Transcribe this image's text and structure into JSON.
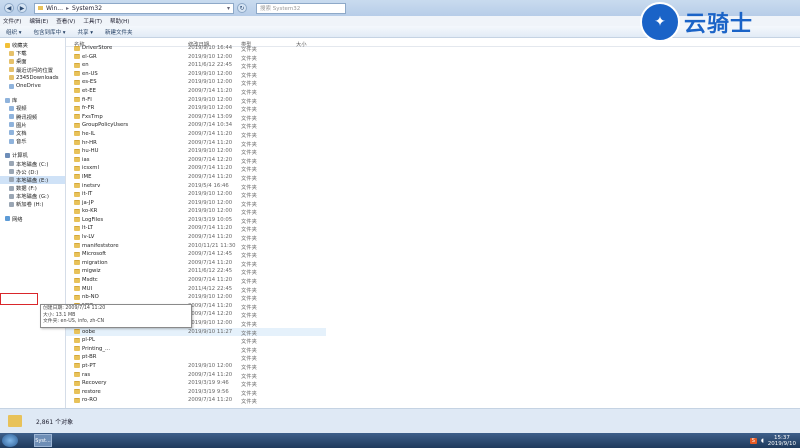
{
  "titlebar": {
    "path": [
      "Win...",
      "System32"
    ],
    "search_placeholder": "搜索 System32"
  },
  "menu": [
    "文件(F)",
    "编辑(E)",
    "查看(V)",
    "工具(T)",
    "帮助(H)"
  ],
  "toolbar": [
    "组织 ▾",
    "包含到库中 ▾",
    "共享 ▾",
    "新建文件夹"
  ],
  "sidebar": {
    "favorites": {
      "title": "收藏夹",
      "items": [
        "下载",
        "桌面",
        "最近访问的位置",
        "2345Downloads",
        "OneDrive"
      ]
    },
    "libraries": {
      "title": "库",
      "items": [
        "视频",
        "腾讯视频",
        "图片",
        "文档",
        "音乐"
      ]
    },
    "computer": {
      "title": "计算机",
      "items": [
        "本地磁盘 (C:)",
        "办公 (D:)",
        "本地磁盘 (E:)",
        "数据 (F:)",
        "本地磁盘 (G:)",
        "新加卷 (H:)"
      ]
    },
    "network": {
      "title": "网络"
    }
  },
  "columns": {
    "name": "名称",
    "date": "修改日期",
    "type": "类型",
    "size": "大小"
  },
  "files": [
    {
      "name": "DriverStore",
      "date": "2019/9/10 16:44",
      "type": "文件夹"
    },
    {
      "name": "el-GR",
      "date": "2019/9/10 12:00",
      "type": "文件夹"
    },
    {
      "name": "en",
      "date": "2011/6/12 22:45",
      "type": "文件夹"
    },
    {
      "name": "en-US",
      "date": "2019/9/10 12:00",
      "type": "文件夹"
    },
    {
      "name": "es-ES",
      "date": "2019/9/10 12:00",
      "type": "文件夹"
    },
    {
      "name": "et-EE",
      "date": "2009/7/14 11:20",
      "type": "文件夹"
    },
    {
      "name": "fi-FI",
      "date": "2019/9/10 12:00",
      "type": "文件夹"
    },
    {
      "name": "fr-FR",
      "date": "2019/9/10 12:00",
      "type": "文件夹"
    },
    {
      "name": "FxsTmp",
      "date": "2009/7/14 13:09",
      "type": "文件夹"
    },
    {
      "name": "GroupPolicyUsers",
      "date": "2009/7/14 10:34",
      "type": "文件夹"
    },
    {
      "name": "he-IL",
      "date": "2009/7/14 11:20",
      "type": "文件夹"
    },
    {
      "name": "hr-HR",
      "date": "2009/7/14 11:20",
      "type": "文件夹"
    },
    {
      "name": "hu-HU",
      "date": "2019/9/10 12:00",
      "type": "文件夹"
    },
    {
      "name": "ias",
      "date": "2009/7/14 12:20",
      "type": "文件夹"
    },
    {
      "name": "icsxml",
      "date": "2009/7/14 11:20",
      "type": "文件夹"
    },
    {
      "name": "IME",
      "date": "2009/7/14 11:20",
      "type": "文件夹"
    },
    {
      "name": "inetsrv",
      "date": "2019/5/4 16:46",
      "type": "文件夹"
    },
    {
      "name": "it-IT",
      "date": "2019/9/10 12:00",
      "type": "文件夹"
    },
    {
      "name": "ja-JP",
      "date": "2019/9/10 12:00",
      "type": "文件夹"
    },
    {
      "name": "ko-KR",
      "date": "2019/9/10 12:00",
      "type": "文件夹"
    },
    {
      "name": "LogFiles",
      "date": "2019/3/19 10:05",
      "type": "文件夹"
    },
    {
      "name": "lt-LT",
      "date": "2009/7/14 11:20",
      "type": "文件夹"
    },
    {
      "name": "lv-LV",
      "date": "2009/7/14 11:20",
      "type": "文件夹"
    },
    {
      "name": "manifeststore",
      "date": "2010/11/21 11:30",
      "type": "文件夹"
    },
    {
      "name": "Microsoft",
      "date": "2009/7/14 12:45",
      "type": "文件夹"
    },
    {
      "name": "migration",
      "date": "2009/7/14 11:20",
      "type": "文件夹"
    },
    {
      "name": "migwiz",
      "date": "2011/6/12 22:45",
      "type": "文件夹"
    },
    {
      "name": "Msdtc",
      "date": "2009/7/14 11:20",
      "type": "文件夹"
    },
    {
      "name": "MUI",
      "date": "2011/4/12 22:45",
      "type": "文件夹"
    },
    {
      "name": "nb-NO",
      "date": "2019/9/10 12:00",
      "type": "文件夹"
    },
    {
      "name": "NDF",
      "date": "2009/7/14 11:20",
      "type": "文件夹"
    },
    {
      "name": "NetworkList",
      "date": "2009/7/14 12:20",
      "type": "文件夹"
    },
    {
      "name": "nl-NL",
      "date": "2019/9/10 12:00",
      "type": "文件夹"
    },
    {
      "name": "oobe",
      "date": "2019/9/10 11:27",
      "type": "文件夹"
    },
    {
      "name": "pl-PL",
      "date": "",
      "type": "文件夹"
    },
    {
      "name": "Printing_...",
      "date": "",
      "type": "文件夹"
    },
    {
      "name": "pt-BR",
      "date": "",
      "type": "文件夹"
    },
    {
      "name": "pt-PT",
      "date": "2019/9/10 12:00",
      "type": "文件夹"
    },
    {
      "name": "ras",
      "date": "2009/7/14 11:20",
      "type": "文件夹"
    },
    {
      "name": "Recovery",
      "date": "2019/3/19 9:46",
      "type": "文件夹"
    },
    {
      "name": "restore",
      "date": "2019/3/19 9:56",
      "type": "文件夹"
    },
    {
      "name": "ro-RO",
      "date": "2009/7/14 11:20",
      "type": "文件夹"
    }
  ],
  "tooltip": {
    "line1": "创建日期: 2009/7/14 11:20",
    "line2": "大小: 13.1 MB",
    "line3": "文件夹: en-US, info, zh-CN",
    "line4": "文件: audit.exe, background.bmp, cmisetup.dll, diagER.dll, ..."
  },
  "status": {
    "count": "2,861 个对象"
  },
  "taskbar": {
    "button": "Syst...",
    "ime": "S",
    "time": "15:37",
    "date": "2019/9/10"
  },
  "watermark": {
    "text": "云骑士"
  }
}
